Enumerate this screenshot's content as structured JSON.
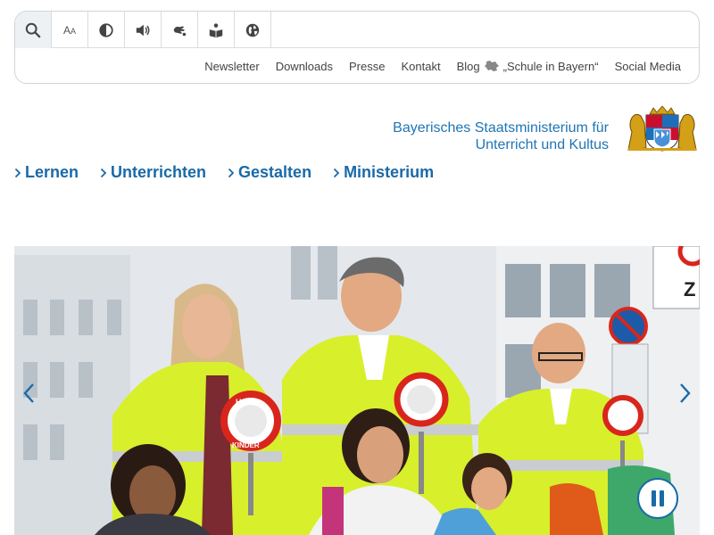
{
  "toolbar": {
    "tools": [
      {
        "name": "search-icon"
      },
      {
        "name": "font-size-icon",
        "text": "A",
        "text_small": "A"
      },
      {
        "name": "contrast-icon"
      },
      {
        "name": "speaker-icon"
      },
      {
        "name": "sign-language-icon"
      },
      {
        "name": "easy-language-icon"
      },
      {
        "name": "globe-icon"
      }
    ]
  },
  "sublinks": {
    "newsletter": "Newsletter",
    "downloads": "Downloads",
    "presse": "Presse",
    "kontakt": "Kontakt",
    "blog_prefix": "Blog",
    "blog_suffix": "„Schule in Bayern“",
    "social": "Social Media"
  },
  "brand": {
    "line1": "Bayerisches Staatsministerium für",
    "line2": "Unterricht und Kultus"
  },
  "mainnav": {
    "lernen": "Lernen",
    "unterrichten": "Unterrichten",
    "gestalten": "Gestalten",
    "ministerium": "Ministerium"
  },
  "hero": {
    "sign_top": "HALT",
    "sign_bottom": "KINDER",
    "street_sign_letter": "Z"
  },
  "colors": {
    "accent": "#1a6aa8",
    "brand_text": "#1f75b5",
    "hi_vis": "#d8ef2c"
  }
}
